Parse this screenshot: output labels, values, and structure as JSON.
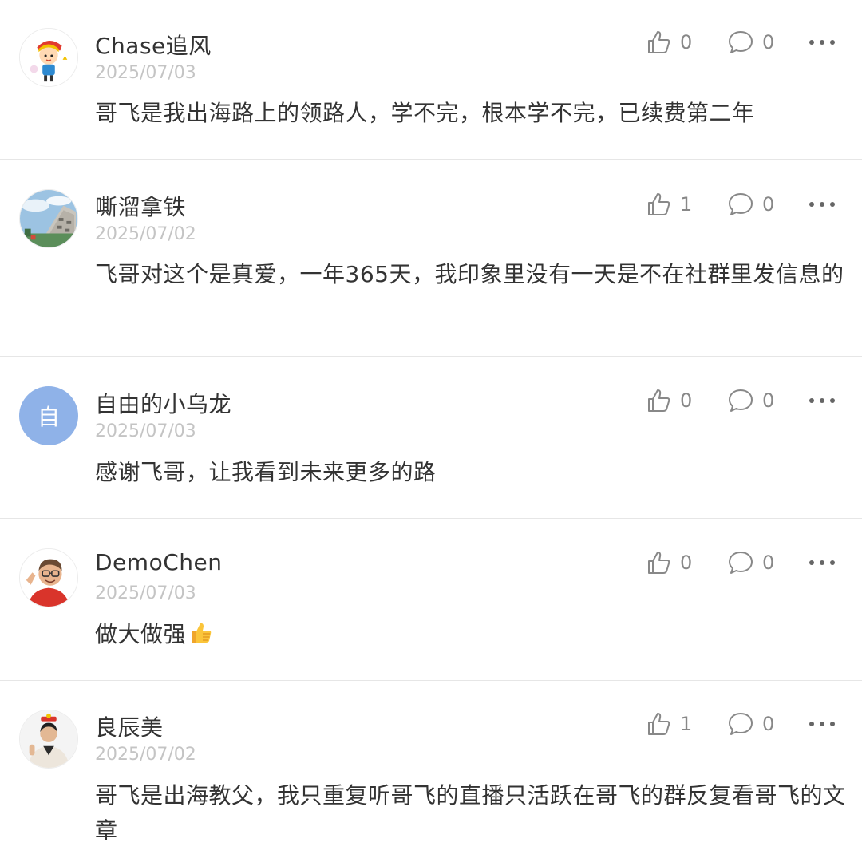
{
  "comments": [
    {
      "username": "Chase追风",
      "date": "2025/07/03",
      "text": "哥飞是我出海路上的领路人，学不完，根本学不完，已续费第二年",
      "likes": "0",
      "replies": "0",
      "avatar_icon": "cartoon-avatar-icon"
    },
    {
      "username": "嘶溜拿铁",
      "date": "2025/07/02",
      "text": "飞哥对这个是真爱，一年365天，我印象里没有一天是不在社群里发信息的",
      "likes": "1",
      "replies": "0",
      "avatar_icon": "building-photo-avatar-icon"
    },
    {
      "username": "自由的小乌龙",
      "date": "2025/07/03",
      "text": "感谢飞哥，让我看到未来更多的路",
      "likes": "0",
      "replies": "0",
      "avatar_letter": "自",
      "avatar_color": "#8fb2e8"
    },
    {
      "username": "DemoChen",
      "date": "2025/07/03",
      "text": "做大做强",
      "text_emoji": "thumbs-up-emoji",
      "likes": "0",
      "replies": "0",
      "avatar_icon": "memoji-avatar-icon"
    },
    {
      "username": "良辰美",
      "date": "2025/07/02",
      "text": "哥飞是出海教父，我只重复听哥飞的直播只活跃在哥飞的群反复看哥飞的文章",
      "likes": "1",
      "replies": "0",
      "avatar_icon": "person-photo-avatar-icon"
    }
  ],
  "colors": {
    "text": "#333333",
    "meta": "#c4c4c4",
    "action": "#888888",
    "divider": "#e6e6e6"
  }
}
